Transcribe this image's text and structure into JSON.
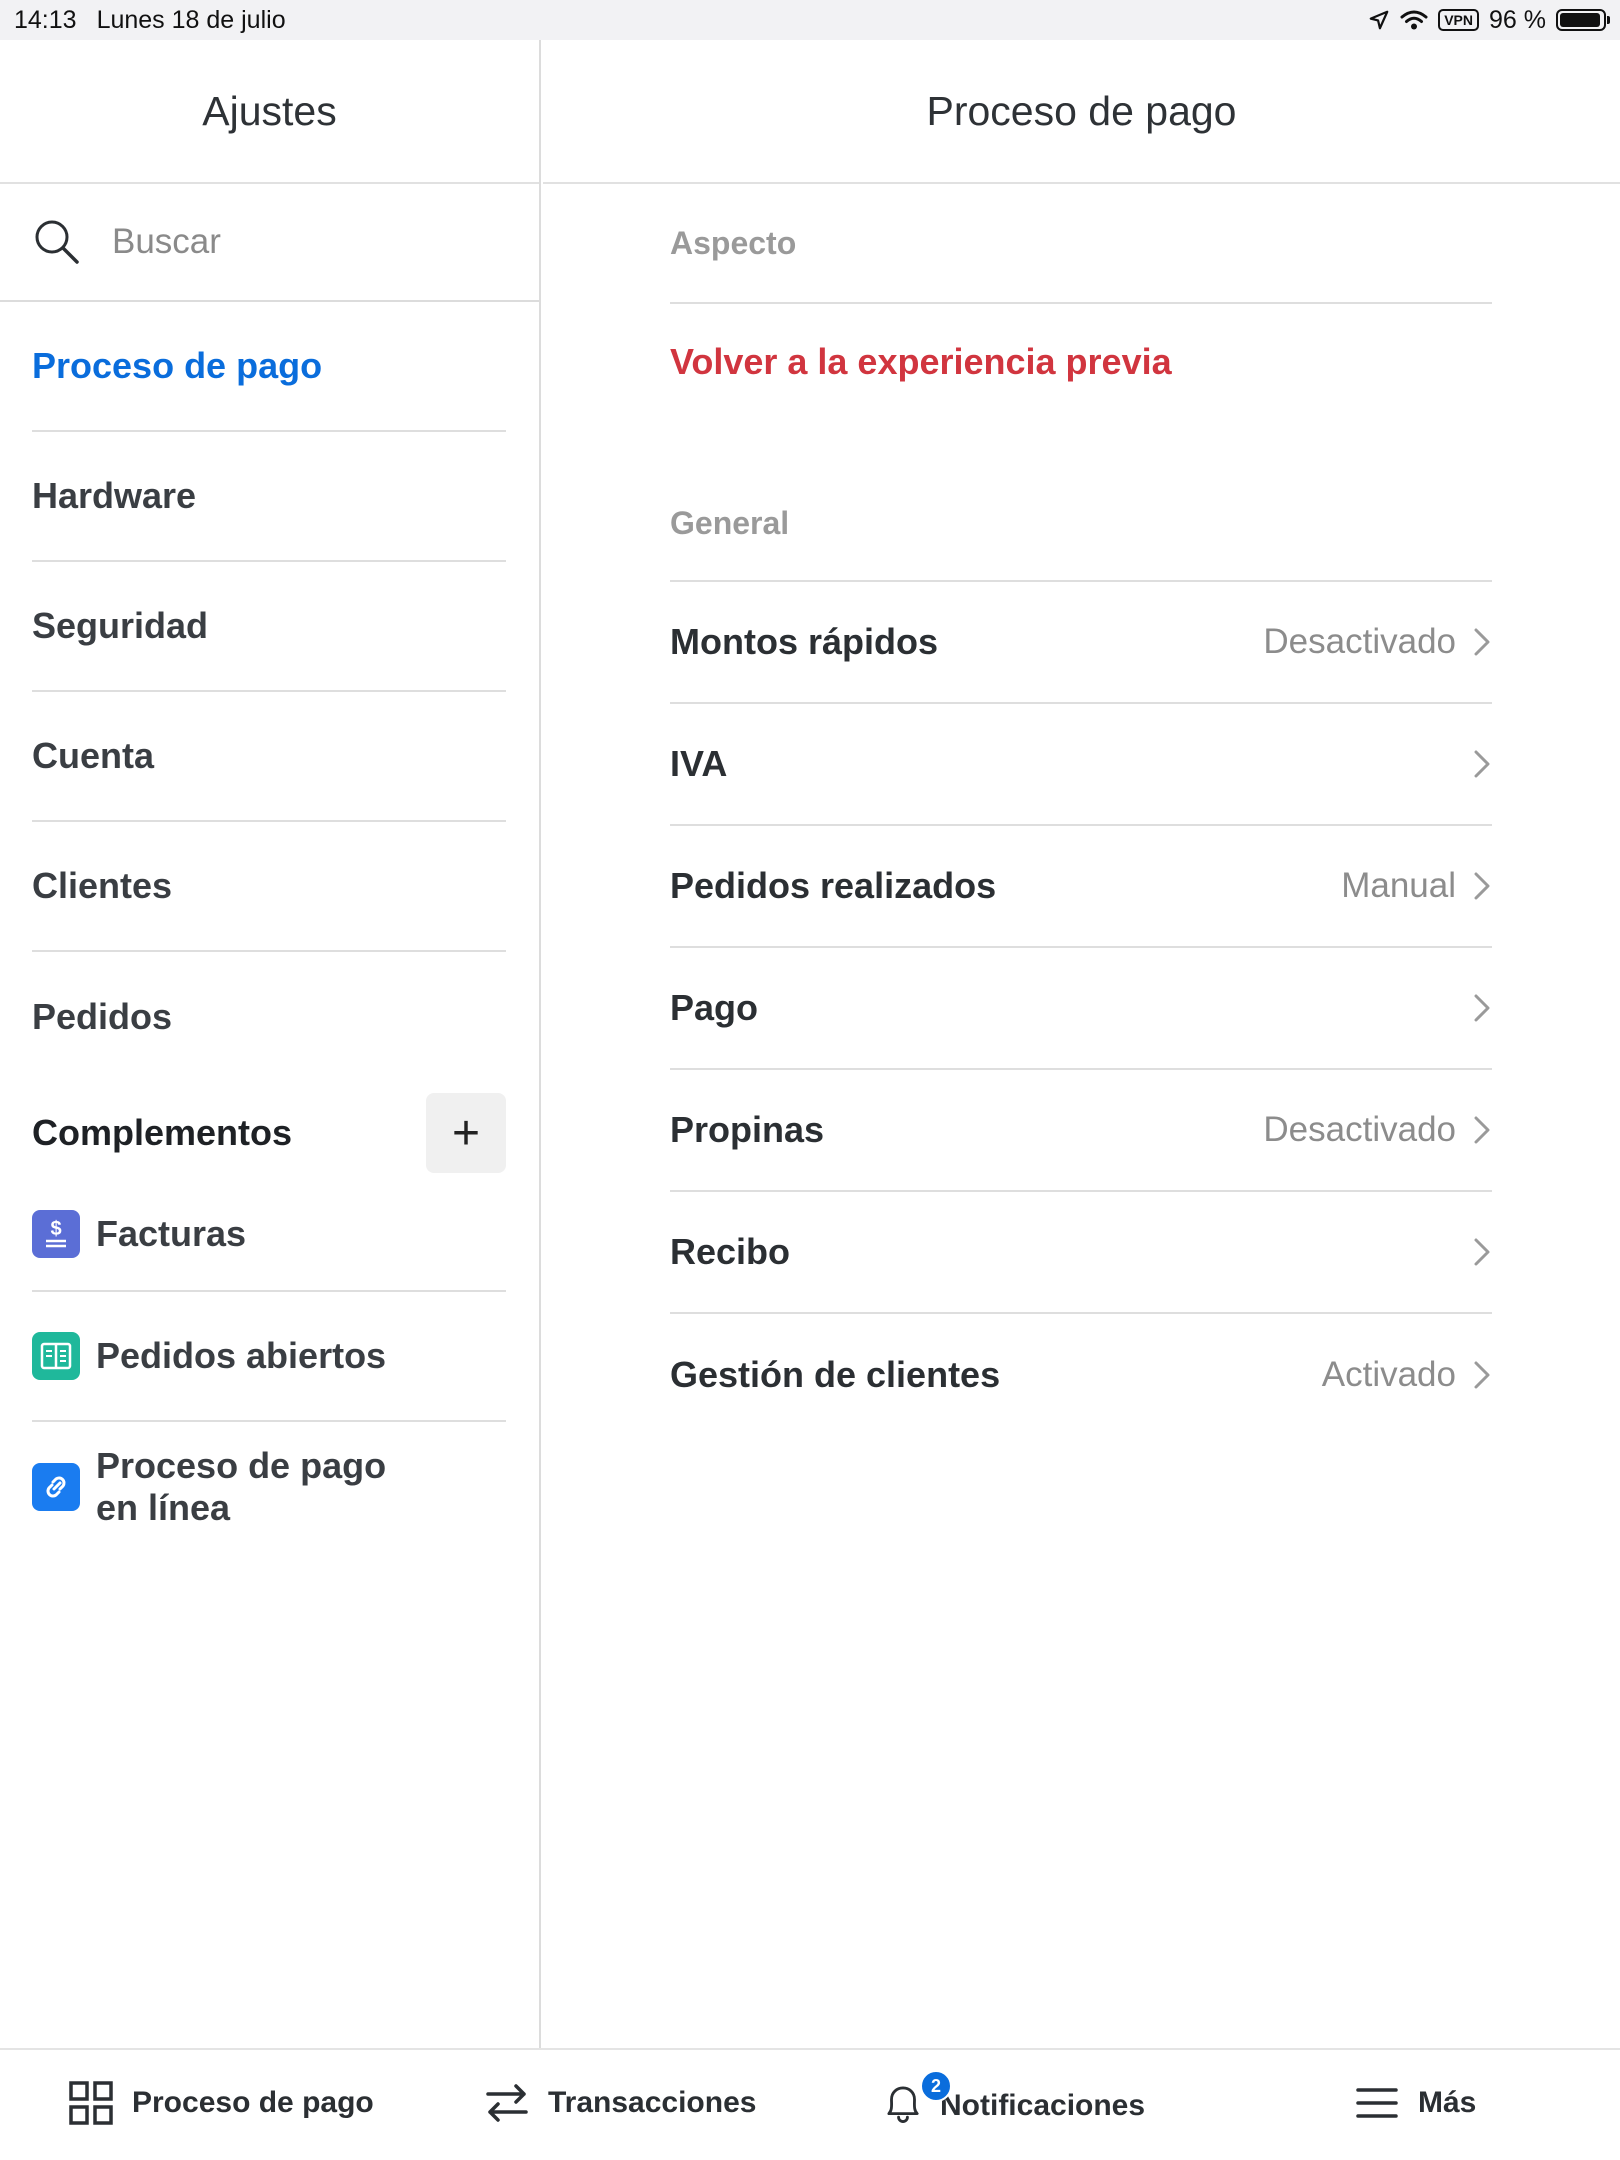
{
  "status_bar": {
    "time": "14:13",
    "date": "Lunes 18 de julio",
    "vpn": "VPN",
    "battery": "96 %",
    "battery_level": 0.96
  },
  "sidebar": {
    "title": "Ajustes",
    "search_placeholder": "Buscar",
    "items": [
      {
        "label": "Proceso de pago",
        "active": true
      },
      {
        "label": "Hardware"
      },
      {
        "label": "Seguridad"
      },
      {
        "label": "Cuenta"
      },
      {
        "label": "Clientes"
      },
      {
        "label": "Pedidos"
      }
    ],
    "addons_title": "Complementos",
    "add_button": "+",
    "addons": [
      {
        "label": "Facturas",
        "icon": "invoice-icon",
        "color": "#5b6ed6"
      },
      {
        "label": "Pedidos abiertos",
        "icon": "open-orders-icon",
        "color": "#1fb89b"
      },
      {
        "label": "Proceso de pago en línea",
        "icon": "link-icon",
        "color": "#1a7cf0"
      }
    ]
  },
  "detail": {
    "title": "Proceso de pago",
    "appearance_label": "Aspecto",
    "revert_link": "Volver a la experiencia previa",
    "general_label": "General",
    "rows": [
      {
        "label": "Montos rápidos",
        "value": "Desactivado"
      },
      {
        "label": "IVA",
        "value": ""
      },
      {
        "label": "Pedidos realizados",
        "value": "Manual"
      },
      {
        "label": "Pago",
        "value": ""
      },
      {
        "label": "Propinas",
        "value": "Desactivado"
      },
      {
        "label": "Recibo",
        "value": ""
      },
      {
        "label": "Gestión de clientes",
        "value": "Activado"
      }
    ]
  },
  "tab_bar": {
    "tabs": [
      {
        "label": "Proceso de pago",
        "icon": "grid-icon"
      },
      {
        "label": "Transacciones",
        "icon": "transfer-icon"
      },
      {
        "label": "Notificaciones",
        "icon": "bell-icon",
        "badge": "2"
      },
      {
        "label": "Más",
        "icon": "menu-icon"
      }
    ]
  },
  "colors": {
    "accent": "#0a6ddc",
    "danger": "#d1353f",
    "muted": "#9a9a9a"
  }
}
